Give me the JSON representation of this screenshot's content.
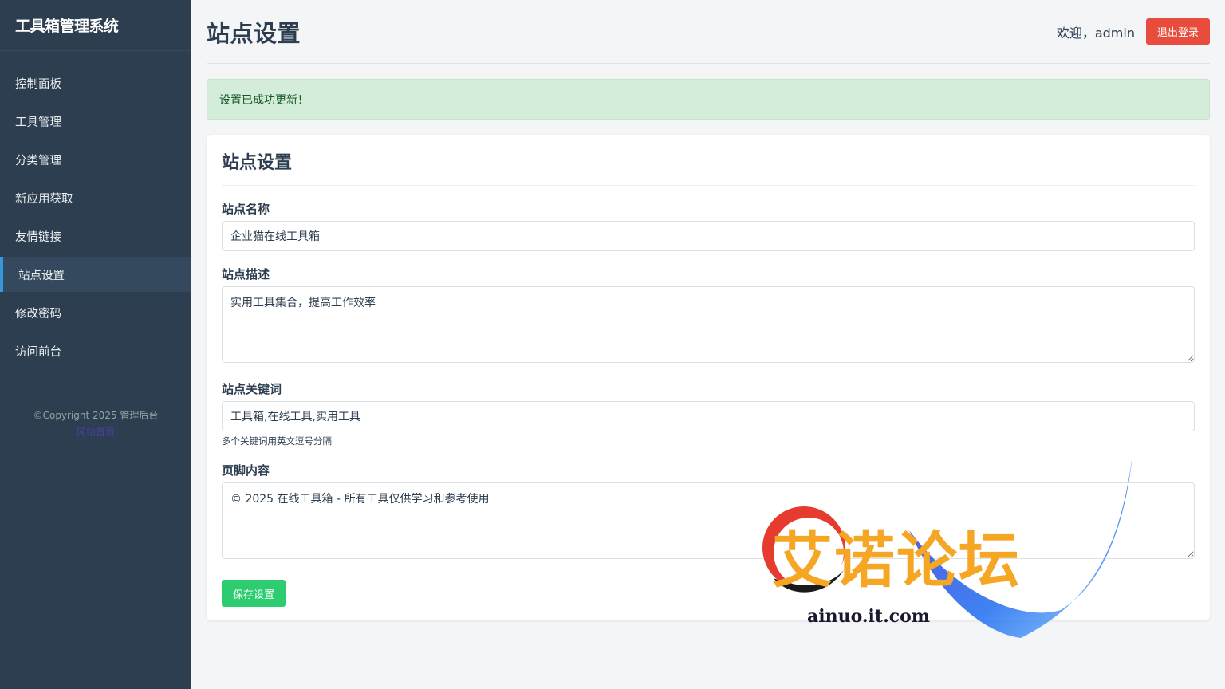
{
  "sidebar": {
    "brand": "工具箱管理系统",
    "items": [
      {
        "label": "控制面板"
      },
      {
        "label": "工具管理"
      },
      {
        "label": "分类管理"
      },
      {
        "label": "新应用获取"
      },
      {
        "label": "友情链接"
      },
      {
        "label": "站点设置",
        "active": true
      },
      {
        "label": "修改密码"
      },
      {
        "label": "访问前台"
      }
    ],
    "copyright": "©Copyright 2025 管理后台",
    "footer_link": "网站首页"
  },
  "header": {
    "title": "站点设置",
    "welcome": "欢迎，admin",
    "logout_label": "退出登录"
  },
  "alert": {
    "message": "设置已成功更新！"
  },
  "form": {
    "title": "站点设置",
    "site_name": {
      "label": "站点名称",
      "value": "企业猫在线工具箱"
    },
    "site_desc": {
      "label": "站点描述",
      "value": "实用工具集合，提高工作效率"
    },
    "site_keywords": {
      "label": "站点关键词",
      "value": "工具箱,在线工具,实用工具",
      "help": "多个关键词用英文逗号分隔"
    },
    "footer": {
      "label": "页脚内容",
      "value": "© 2025 在线工具箱 - 所有工具仅供学习和参考使用"
    },
    "save_label": "保存设置"
  },
  "watermark": {
    "text": "艾诺论坛",
    "domain": "ainuo.it.com"
  },
  "colors": {
    "sidebar_bg": "#2c3e50",
    "active_accent": "#3498db",
    "logout": "#e74c3c",
    "save": "#2ecc71",
    "alert_bg": "#d4edda"
  }
}
